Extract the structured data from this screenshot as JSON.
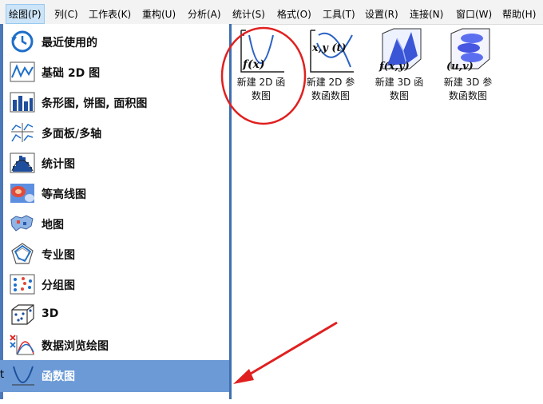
{
  "menu": [
    "绘图(P)",
    "列(C)",
    "工作表(K)",
    "重构(U)",
    "分析(A)",
    "统计(S)",
    "格式(O)",
    "工具(T)",
    "设置(R)",
    "连接(N)",
    "窗口(W)",
    "帮助(H)"
  ],
  "submenu": [
    {
      "label": "最近使用的",
      "icon": "clock-icon"
    },
    {
      "label": "基础 2D 图",
      "icon": "line-plot-icon"
    },
    {
      "label": "条形图, 饼图, 面积图",
      "icon": "bar-chart-icon"
    },
    {
      "label": "多面板/多轴",
      "icon": "multi-panel-icon"
    },
    {
      "label": "统计图",
      "icon": "histogram-icon"
    },
    {
      "label": "等高线图",
      "icon": "contour-icon"
    },
    {
      "label": "地图",
      "icon": "map-icon"
    },
    {
      "label": "专业图",
      "icon": "radar-icon"
    },
    {
      "label": "分组图",
      "icon": "grouped-plot-icon"
    },
    {
      "label": "3D",
      "icon": "3d-cube-icon"
    },
    {
      "label": "数据浏览绘图",
      "icon": "data-browser-icon"
    },
    {
      "label": "函数图",
      "icon": "function-plot-icon"
    }
  ],
  "selected_index": 11,
  "templates": [
    {
      "caption1": "新建 2D 函",
      "caption2": "数图",
      "icon_text": "f(x)"
    },
    {
      "caption1": "新建 2D 参",
      "caption2": "数函数图",
      "icon_text": "x,y (t)"
    },
    {
      "caption1": "新建 3D 函",
      "caption2": "数图",
      "icon_text": "f(x,y)"
    },
    {
      "caption1": "新建 3D 参",
      "caption2": "数函数图",
      "icon_text": "(u,v)"
    }
  ],
  "edge_text": "t",
  "colors": {
    "selected": "#6b9ad6",
    "annotation": "#e02020",
    "accent": "#3f6fb0"
  }
}
